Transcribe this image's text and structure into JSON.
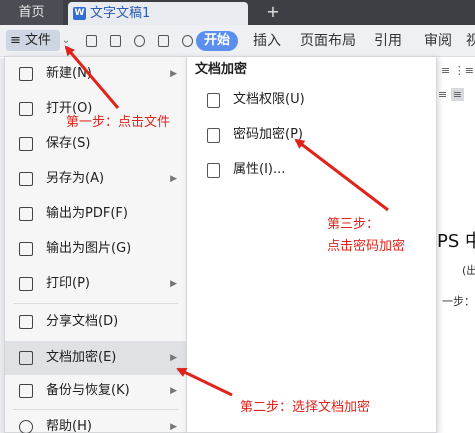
{
  "tabbar": {
    "home": "首页",
    "doc_title": "文字文稿1",
    "doc_icon": "W",
    "add": "+"
  },
  "toolbar": {
    "file_label": "≡ 文件",
    "file_caret": "⌄",
    "start": "开始",
    "ribbon_tabs": [
      "插入",
      "页面布局",
      "引用",
      "审阅",
      "视"
    ]
  },
  "file_menu": {
    "items": [
      {
        "label": "新建(N)",
        "icon": "new-icon",
        "has_submenu": true
      },
      {
        "label": "打开(O)",
        "icon": "folder-icon",
        "has_submenu": false
      },
      {
        "label": "保存(S)",
        "icon": "save-icon",
        "has_submenu": false
      },
      {
        "label": "另存为(A)",
        "icon": "save-as-icon",
        "has_submenu": true
      },
      {
        "label": "输出为PDF(F)",
        "icon": "pdf-icon",
        "has_submenu": false
      },
      {
        "label": "输出为图片(G)",
        "icon": "image-icon",
        "has_submenu": false
      },
      {
        "label": "打印(P)",
        "icon": "printer-icon",
        "has_submenu": true
      },
      {
        "label": "分享文档(D)",
        "icon": "share-icon",
        "has_submenu": false
      },
      {
        "label": "文档加密(E)",
        "icon": "lock-doc-icon",
        "has_submenu": true,
        "selected": true
      },
      {
        "label": "备份与恢复(K)",
        "icon": "backup-icon",
        "has_submenu": true
      },
      {
        "label": "帮助(H)",
        "icon": "help-icon",
        "has_submenu": true
      }
    ]
  },
  "encrypt_submenu": {
    "title": "文档加密",
    "items": [
      {
        "label": "文档权限(U)",
        "icon": "permission-icon"
      },
      {
        "label": "密码加密(P)",
        "icon": "password-lock-icon"
      },
      {
        "label": "属性(I)...",
        "icon": "properties-icon"
      }
    ]
  },
  "annotations": {
    "step1": "第一步：点击文件",
    "step2": "第二步：选择文档加密",
    "step3_line1": "第三步：",
    "step3_line2": "点击密码加密",
    "arrow_color": "#e0241b"
  },
  "document": {
    "text1": "PS 中",
    "text2": "(出",
    "text3": "一步：点"
  }
}
